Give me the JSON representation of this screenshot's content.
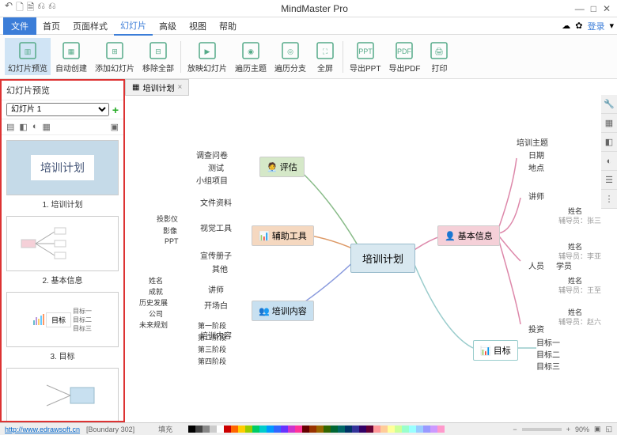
{
  "app": {
    "title": "MindMaster Pro"
  },
  "quickbar": [
    "↶",
    "🗋",
    "🗎",
    "⎌",
    "⎌"
  ],
  "winbtns": [
    "—",
    "□",
    "✕"
  ],
  "menu": {
    "file": "文件",
    "tabs": [
      "首页",
      "页面样式",
      "幻灯片",
      "高级",
      "视图",
      "帮助"
    ],
    "active": 2,
    "login": "登录"
  },
  "ribbon": [
    {
      "label": "幻灯片预览",
      "active": true
    },
    {
      "label": "自动创建"
    },
    {
      "label": "添加幻灯片"
    },
    {
      "label": "移除全部"
    },
    {
      "sep": true
    },
    {
      "label": "放映幻灯片"
    },
    {
      "label": "遍历主题"
    },
    {
      "label": "遍历分支"
    },
    {
      "label": "全屏"
    },
    {
      "sep": true
    },
    {
      "label": "导出PPT"
    },
    {
      "label": "导出PDF"
    },
    {
      "label": "打印"
    }
  ],
  "sidebar": {
    "title": "幻灯片预览",
    "select": "幻灯片 1",
    "slides": [
      {
        "title": "培训计划",
        "caption": "1. 培训计划",
        "type": "title"
      },
      {
        "caption": "2. 基本信息",
        "type": "tree"
      },
      {
        "caption": "3. 目标",
        "type": "chart",
        "box": "目标",
        "subs": [
          "目标一",
          "目标二",
          "目标三"
        ]
      }
    ]
  },
  "doctab": "培训计划",
  "nodes": {
    "center": "培训计划",
    "eval": "评估",
    "eval_items": [
      "调查问卷",
      "测试",
      "小组项目"
    ],
    "tools": "辅助工具",
    "tools_items": [
      "文件资料",
      "视觉工具",
      "宣传册子",
      "其他"
    ],
    "tools_sub": [
      "投影仪",
      "影像",
      "PPT"
    ],
    "content": "培训内容",
    "content_items": [
      "讲师",
      "开场白",
      "培训内容"
    ],
    "content_sub": [
      "姓名",
      "成就",
      "历史发展",
      "公司",
      "未来规划"
    ],
    "content_phase": [
      "第一阶段",
      "第二阶段",
      "第三阶段",
      "第四阶段"
    ],
    "basic": "基本信息",
    "basic_items": [
      "培训主题",
      "日期",
      "地点",
      "讲师",
      "人员",
      "投资"
    ],
    "students": "学员",
    "student_items": [
      "姓名",
      "姓名",
      "姓名",
      "姓名"
    ],
    "student_subs": [
      "辅导员：张三",
      "辅导员：李亚",
      "辅导员：王至",
      "辅导员：赵六"
    ],
    "goal": "目标",
    "goal_items": [
      "目标一",
      "目标二",
      "目标三"
    ]
  },
  "status": {
    "url": "http://www.edrawsoft.cn",
    "boundary": "[Boundary 302]",
    "fill": "填充",
    "zoom": "90%"
  },
  "palette": [
    "#000",
    "#444",
    "#888",
    "#ccc",
    "#fff",
    "#c00",
    "#f60",
    "#fc0",
    "#9c0",
    "#0c6",
    "#0cc",
    "#09f",
    "#36f",
    "#63f",
    "#c3c",
    "#f39",
    "#600",
    "#930",
    "#960",
    "#360",
    "#063",
    "#066",
    "#036",
    "#339",
    "#306",
    "#603",
    "#f99",
    "#fc9",
    "#ff9",
    "#cf9",
    "#9fc",
    "#9ff",
    "#9cf",
    "#99f",
    "#c9f",
    "#f9c"
  ]
}
